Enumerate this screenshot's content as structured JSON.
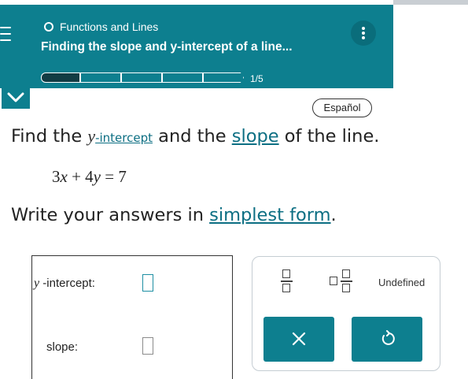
{
  "header": {
    "topic": "Functions and Lines",
    "subtitle": "Finding the slope and y-intercept of a line...",
    "progress": {
      "current": 1,
      "total": 5,
      "label": "1/5"
    }
  },
  "language_button": "Español",
  "question": {
    "part1": "Find the ",
    "var_y": "y",
    "intercept_term": "-intercept",
    "part2": " and the ",
    "slope_term": "slope",
    "part3": " of the line."
  },
  "equation": {
    "coef_a": "3",
    "var_x": "x",
    "plus": " + ",
    "coef_b": "4",
    "var_y": "y",
    "equals": " = ",
    "rhs": "7"
  },
  "instruction": {
    "part1": "Write your answers in ",
    "term": "simplest form",
    "part2": "."
  },
  "answers": {
    "intercept_var": "y",
    "intercept_label": " -intercept:",
    "slope_label": "slope:",
    "intercept_value": "",
    "slope_value": ""
  },
  "keypad": {
    "undefined_label": "Undefined"
  },
  "icons": {
    "menu": "menu-icon",
    "status": "circle-icon",
    "more": "more-vertical-icon",
    "collapse": "chevron-down-icon",
    "clear": "close-icon",
    "undo": "undo-icon"
  },
  "colors": {
    "header": "#0d7f8f",
    "accent": "#0d6f83",
    "progress_fill": "#123c44"
  }
}
